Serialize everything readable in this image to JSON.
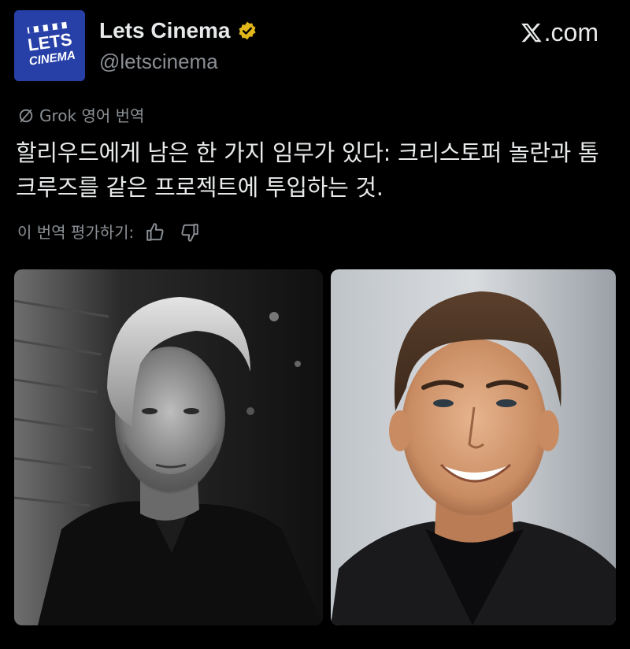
{
  "account": {
    "display_name": "Lets Cinema",
    "handle": "@letscinema",
    "avatar_text_top": "LETS",
    "avatar_text_bottom": "CINEMA",
    "verified": true
  },
  "brand": {
    "label": ".com",
    "icon": "x-logo-icon"
  },
  "translation": {
    "label": "Grok 영어 번역",
    "icon": "grok-icon"
  },
  "post": {
    "text": "할리우드에게 남은 한 가지 임무가 있다: 크리스토퍼 놀란과 톰 크루즈를 같은 프로젝트에 투입하는 것."
  },
  "rating": {
    "label": "이 번역 평가하기:",
    "like_icon": "thumbs-up-icon",
    "dislike_icon": "thumbs-down-icon"
  },
  "media": [
    {
      "kind": "photo",
      "style": "black-and-white portrait"
    },
    {
      "kind": "photo",
      "style": "color portrait"
    }
  ],
  "colors": {
    "background": "#000000",
    "text": "#e7e9ea",
    "muted": "#8b9095",
    "verified_gold": "#e2b719",
    "avatar_blue": "#2740a8"
  }
}
